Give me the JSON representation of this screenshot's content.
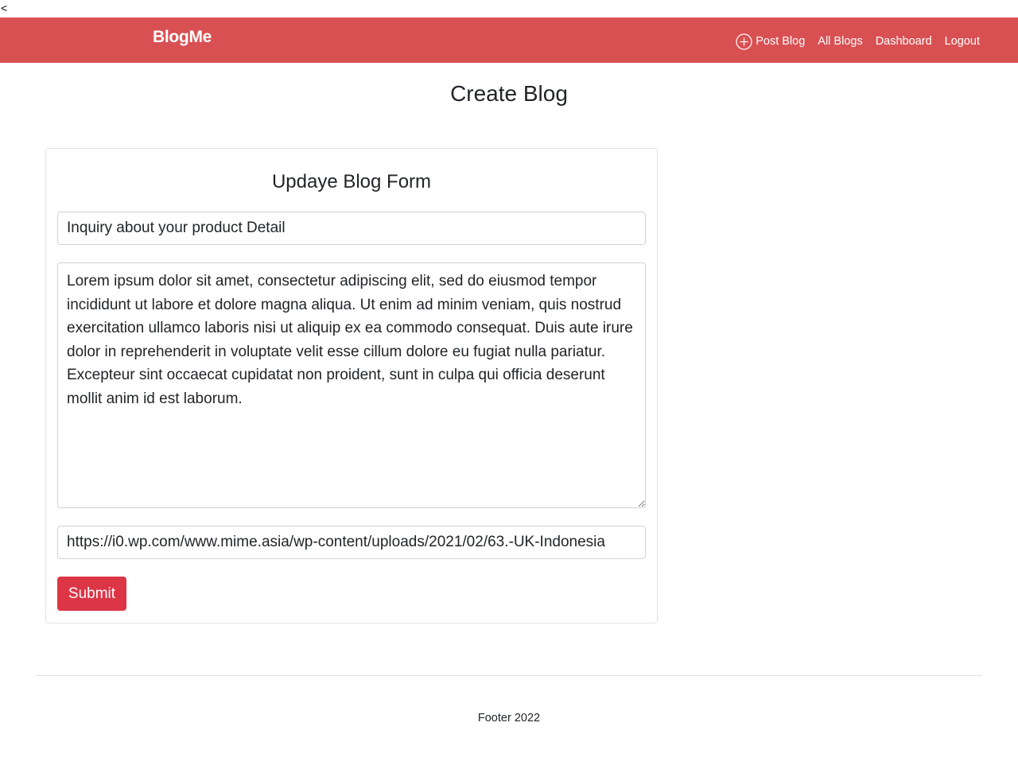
{
  "stray_text": "<",
  "navbar": {
    "brand": "BlogMe",
    "bg_color": "#d95052",
    "links": [
      {
        "label": "Post Blog",
        "icon": "plus-circle-icon"
      },
      {
        "label": "All Blogs"
      },
      {
        "label": "Dashboard"
      },
      {
        "label": "Logout"
      }
    ]
  },
  "page": {
    "title": "Create Blog"
  },
  "form": {
    "title": "Updaye Blog Form",
    "title_value": "Inquiry about your product Detail",
    "body_value": "Lorem ipsum dolor sit amet, consectetur adipiscing elit, sed do eiusmod tempor incididunt ut labore et dolore magna aliqua. Ut enim ad minim veniam, quis nostrud exercitation ullamco laboris nisi ut aliquip ex ea commodo consequat. Duis aute irure dolor in reprehenderit in voluptate velit esse cillum dolore eu fugiat nulla pariatur. Excepteur sint occaecat cupidatat non proident, sunt in culpa qui officia deserunt mollit anim id est laborum.",
    "image_url_value": "https://i0.wp.com/www.mime.asia/wp-content/uploads/2021/02/63.-UK-Indonesia",
    "submit_label": "Submit",
    "submit_color": "#dc3545"
  },
  "footer": {
    "text": "Footer 2022"
  }
}
